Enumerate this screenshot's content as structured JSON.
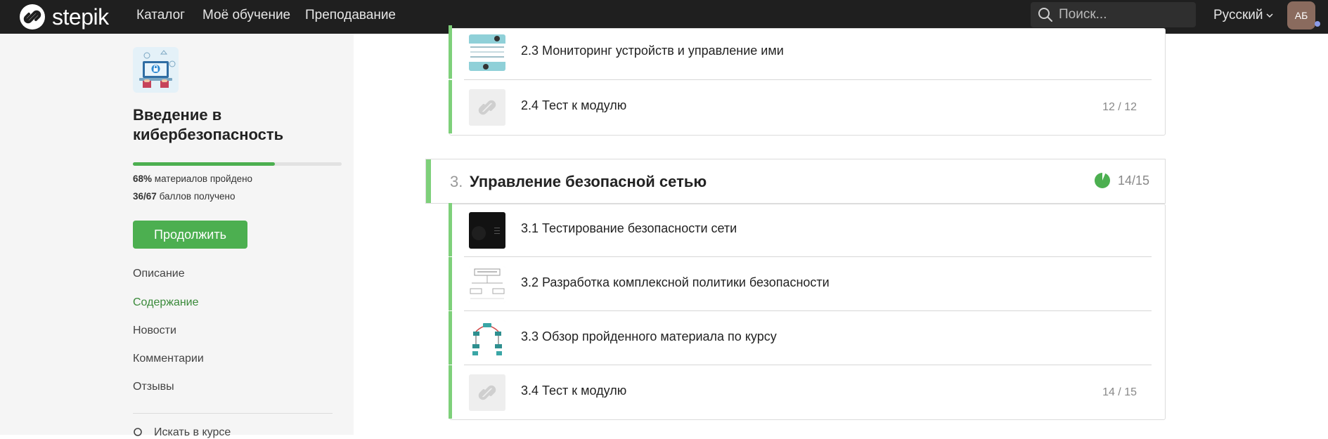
{
  "topbar": {
    "logo_text": "stepik",
    "nav": [
      "Каталог",
      "Моё обучение",
      "Преподавание"
    ],
    "search_placeholder": "Поиск...",
    "language": "Русский",
    "avatar_initials": "АБ"
  },
  "sidebar": {
    "course_title": "Введение в кибербезопасность",
    "progress_percent": 68,
    "materials_percent": "68%",
    "materials_text": "материалов пройдено",
    "points": "36/67",
    "points_text": "баллов получено",
    "continue_label": "Продолжить",
    "links": [
      {
        "label": "Описание",
        "active": false
      },
      {
        "label": "Содержание",
        "active": true
      },
      {
        "label": "Новости",
        "active": false
      },
      {
        "label": "Комментарии",
        "active": false
      },
      {
        "label": "Отзывы",
        "active": false
      }
    ],
    "search_course_label": "Искать в курсе"
  },
  "module2": {
    "lessons": [
      {
        "title": "2.3 Мониторинг устройств и управление ими",
        "score": ""
      },
      {
        "title": "2.4 Тест к модулю",
        "score": "12 / 12"
      }
    ]
  },
  "module3": {
    "number": "3.",
    "title": "Управление безопасной сетью",
    "score": "14/15",
    "lessons": [
      {
        "title": "3.1 Тестирование безопасности сети",
        "score": ""
      },
      {
        "title": "3.2 Разработка комплексной политики безопасности",
        "score": ""
      },
      {
        "title": "3.3 Обзор пройденного материала по курсу",
        "score": ""
      },
      {
        "title": "3.4 Тест к модулю",
        "score": "14 / 15"
      }
    ]
  },
  "colors": {
    "accent": "#4caf50",
    "lesson_bar": "#7ed07a",
    "topbar": "#1f1f1f"
  }
}
